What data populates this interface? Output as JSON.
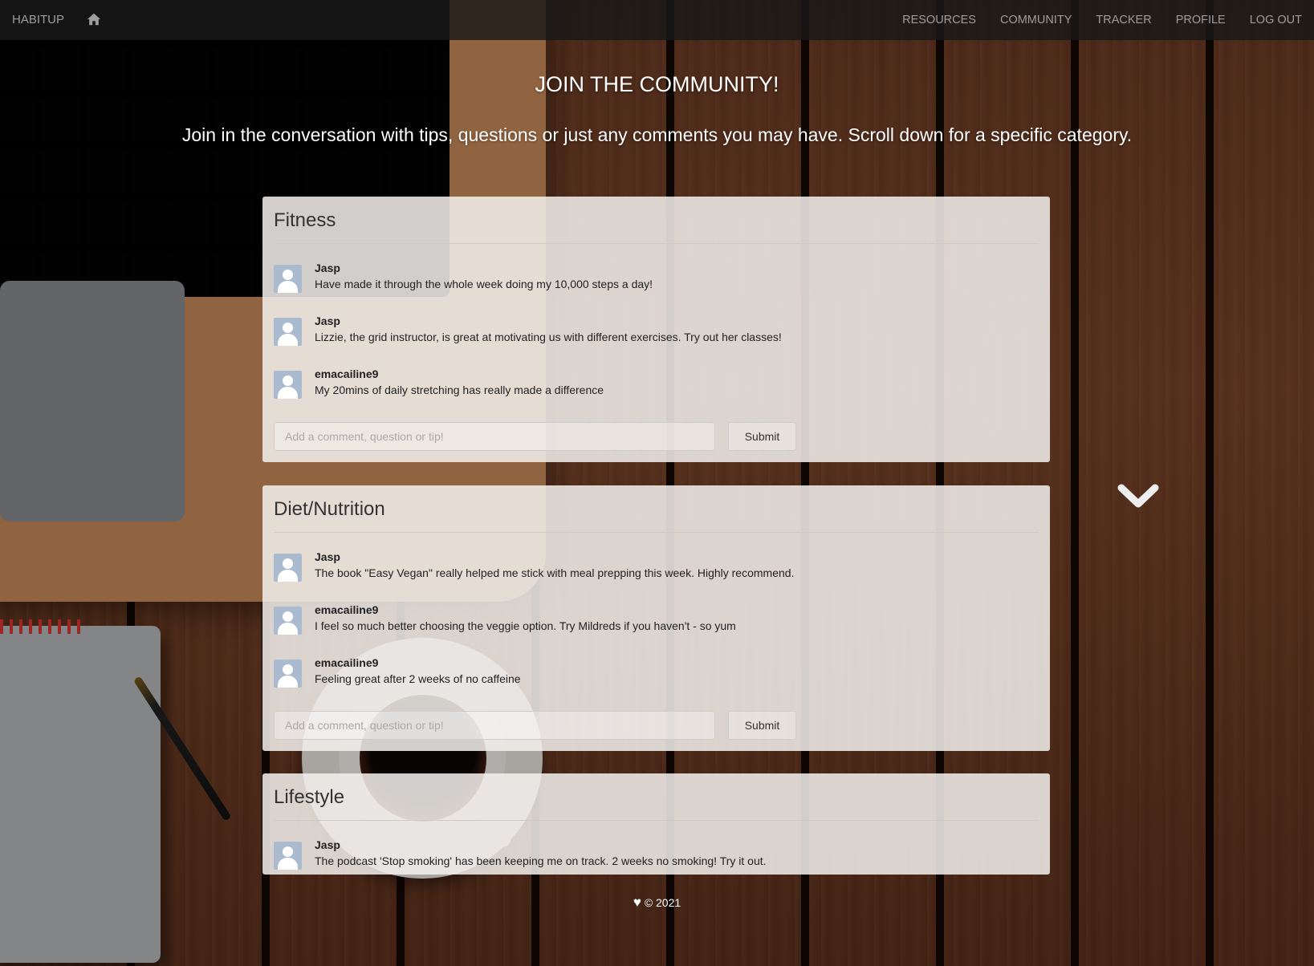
{
  "nav": {
    "brand": "HABITUP",
    "home_icon": "home-icon",
    "links": [
      "RESOURCES",
      "COMMUNITY",
      "TRACKER",
      "PROFILE",
      "LOG OUT"
    ]
  },
  "hero": {
    "title": "JOIN THE COMMUNITY!",
    "subtitle": "Join in the conversation with tips, questions or just any comments you may have. Scroll down for a specific category."
  },
  "panels": [
    {
      "title": "Fitness",
      "comments": [
        {
          "user": "Jasp",
          "text": "Have made it through the whole week doing my 10,000 steps a day!"
        },
        {
          "user": "Jasp",
          "text": "Lizzie, the grid instructor, is great at motivating us with different exercises. Try out her classes!"
        },
        {
          "user": "emacailine9",
          "text": "My 20mins of daily stretching has really made a difference"
        }
      ],
      "input_placeholder": "Add a comment, question or tip!",
      "submit_label": "Submit"
    },
    {
      "title": "Diet/Nutrition",
      "comments": [
        {
          "user": "Jasp",
          "text": "The book \"Easy Vegan\" really helped me stick with meal prepping this week. Highly recommend."
        },
        {
          "user": "emacailine9",
          "text": "I feel so much better choosing the veggie option. Try Mildreds if you haven't - so yum"
        },
        {
          "user": "emacailine9",
          "text": "Feeling great after 2 weeks of no caffeine"
        }
      ],
      "input_placeholder": "Add a comment, question or tip!",
      "submit_label": "Submit"
    },
    {
      "title": "Lifestyle",
      "comments": [
        {
          "user": "Jasp",
          "text": "The podcast 'Stop smoking' has been keeping me on track. 2 weeks no smoking! Try it out."
        }
      ]
    }
  ],
  "scroll_icon": "chevron-down-icon",
  "footer": {
    "heart_icon": "heart-icon",
    "text": "© 2021"
  }
}
